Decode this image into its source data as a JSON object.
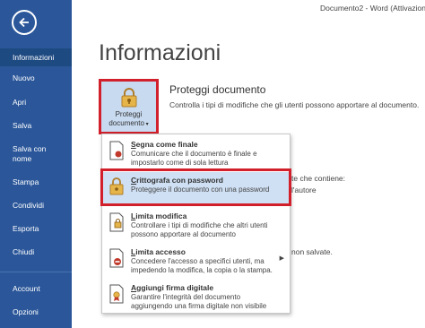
{
  "window": {
    "title": "Documento2 - Word (Attivazione"
  },
  "sidebar": {
    "items": [
      {
        "label": "Informazioni"
      },
      {
        "label": "Nuovo"
      },
      {
        "label": "Apri"
      },
      {
        "label": "Salva"
      },
      {
        "label": "Salva con nome"
      },
      {
        "label": "Stampa"
      },
      {
        "label": "Condividi"
      },
      {
        "label": "Esporta"
      },
      {
        "label": "Chiudi"
      },
      {
        "label": "Account"
      },
      {
        "label": "Opzioni"
      }
    ]
  },
  "page": {
    "title": "Informazioni",
    "protect": {
      "button_label_1": "Proteggi",
      "button_label_2": "documento",
      "section_title": "Proteggi documento",
      "section_desc": "Controlla i tipi di modifiche che gli utenti possono apportare al documento."
    },
    "background": {
      "line1": "te che contiene:",
      "line2": "l'autore",
      "line3": "non salvate."
    }
  },
  "menu": {
    "items": [
      {
        "title_u": "S",
        "title_rest": "egna come finale",
        "desc1": "Comunicare che il documento è finale e",
        "desc2": "impostarlo come di sola lettura"
      },
      {
        "title_u": "C",
        "title_rest": "rittografa con password",
        "desc1": "Proteggere il documento con una password",
        "desc2": ""
      },
      {
        "title_u": "L",
        "title_rest": "imita modifica",
        "desc1": "Controllare i tipi di modifiche che altri utenti",
        "desc2": "possono apportare al documento"
      },
      {
        "title_u": "L",
        "title_rest": "imita accesso",
        "desc1": "Concedere l'accesso a specifici utenti, ma",
        "desc2": "impedendo la modifica, la copia o la stampa."
      },
      {
        "title_u": "A",
        "title_rest": "ggiungi firma digitale",
        "desc1": "Garantire l'integrità del documento",
        "desc2": "aggiungendo una firma digitale non visibile"
      }
    ]
  }
}
